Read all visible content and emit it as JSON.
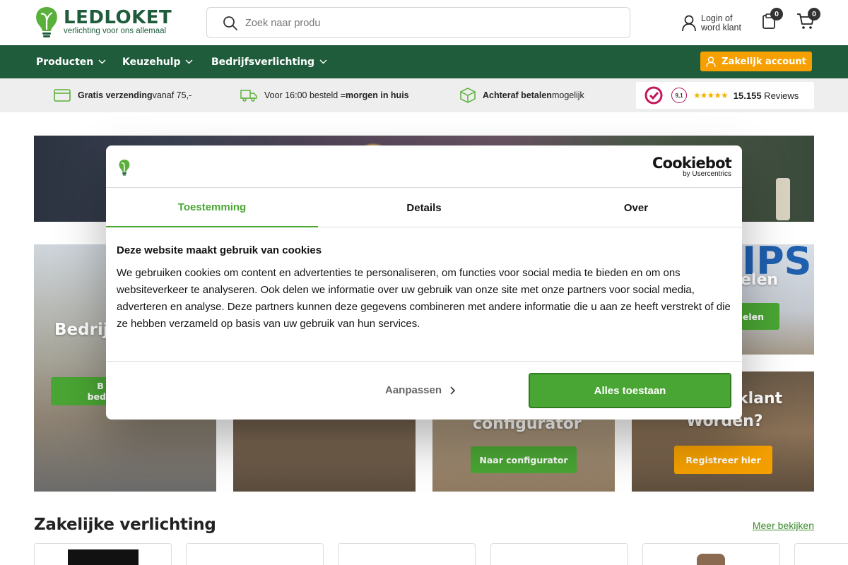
{
  "header": {
    "logo_text": "LEDLOKET",
    "logo_tagline": "verlichting voor ons allemaal",
    "search_placeholder": "Zoek naar produ",
    "login_line1": "Login of",
    "login_line2": "word klant",
    "wishlist_count": "0",
    "cart_count": "0"
  },
  "nav": {
    "items": [
      {
        "label": "Producten"
      },
      {
        "label": "Keuzehulp"
      },
      {
        "label": "Bedrijfsverlichting"
      }
    ],
    "business_button": "Zakelijk account"
  },
  "usp": {
    "shipping_bold": "Gratis verzending",
    "shipping_rest": " vanaf 75,-",
    "delivery_pre": "Voor 16:00 besteld = ",
    "delivery_bold": "morgen in huis",
    "pay_bold": "Achteraf betalen",
    "pay_rest": " mogelijk",
    "review_score": "9,1",
    "review_count": "15.155",
    "review_label": " Reviews"
  },
  "tiles": {
    "t1_title": "Bedrij",
    "t1_btn_line1": "B",
    "t1_btn_line2": "bedri",
    "t3_title": "configurator",
    "t3_button": "Naar configurator",
    "t4_title_a": "IPS",
    "t4_title_b": "elen",
    "t4_button": "nelen",
    "t5_title_a": "klant",
    "t5_title_b": "Worden?",
    "t5_button": "Registreer hier"
  },
  "section": {
    "title": "Zakelijke verlichting",
    "more_link": "Meer bekijken"
  },
  "cookie_dialog": {
    "brand": "Cookiebot",
    "brand_sub": "by Usercentrics",
    "tabs": [
      {
        "label": "Toestemming"
      },
      {
        "label": "Details"
      },
      {
        "label": "Over"
      }
    ],
    "heading": "Deze website maakt gebruik van cookies",
    "body": "We gebruiken cookies om content en advertenties te personaliseren, om functies voor social media te bieden en om ons websiteverkeer te analyseren. Ook delen we informatie over uw gebruik van onze site met onze partners voor social media, adverteren en analyse. Deze partners kunnen deze gegevens combineren met andere informatie die u aan ze heeft verstrekt of die ze hebben verzameld op basis van uw gebruik van hun services.",
    "customize_label": "Aanpassen",
    "allow_all_label": "Alles toestaan"
  },
  "colors": {
    "brand_green": "#1f5c3c",
    "accent_green": "#4aa634",
    "accent_orange": "#f5a000"
  }
}
